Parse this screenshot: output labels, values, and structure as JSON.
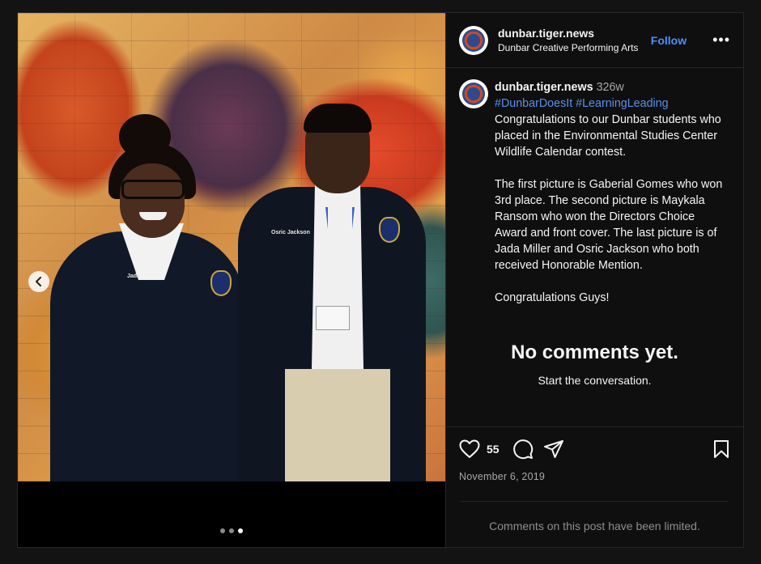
{
  "post": {
    "author": {
      "username": "dunbar.tiger.news",
      "location": "Dunbar Creative Performing Arts"
    },
    "follow_label": "Follow",
    "more_label": "•••",
    "caption": {
      "username": "dunbar.tiger.news",
      "age": "326w",
      "hashtags": "#DunbarDoesIt #LearningLeading",
      "paragraph1": "Congratulations to our Dunbar students who placed in the Environmental Studies Center Wildlife Calendar contest.",
      "paragraph2": "The first picture is Gaberial Gomes who won 3rd place. The second picture is Maykala Ransom who won the Directors Choice Award and front cover. The last picture is of Jada Miller and Osric Jackson who both received Honorable Mention.",
      "paragraph3": "Congratulations Guys!"
    },
    "comments_empty": {
      "title": "No comments yet.",
      "subtitle": "Start the conversation."
    },
    "likes": "55",
    "date": "November 6, 2019",
    "comments_limited": "Comments on this post have been limited.",
    "carousel": {
      "slide_count": 3,
      "active_index": 2
    },
    "photo": {
      "girl_name_tag": "Jada",
      "boy_name_tag": "Osric Jackson"
    }
  },
  "colors": {
    "link": "#4a90f8",
    "hashtag": "#5b8fe8",
    "panel_bg": "#0f0f10",
    "muted": "#a8a8a8"
  },
  "icons": [
    "chevron-left-icon",
    "heart-icon",
    "comment-icon",
    "share-icon",
    "bookmark-icon",
    "more-icon"
  ]
}
